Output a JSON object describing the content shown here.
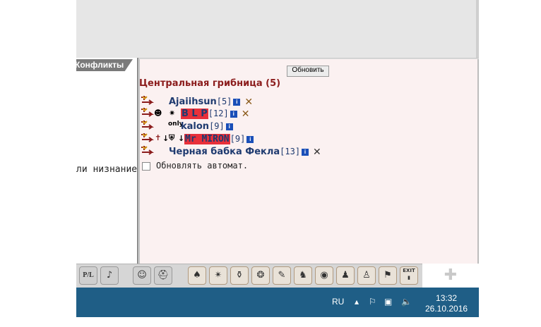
{
  "tabs": {
    "conflicts": "Конфликты"
  },
  "left_panel": {
    "snippet": "ли низнание"
  },
  "chat": {
    "refresh_label": "Обновить",
    "room_title": "Центральная грибница (5)",
    "auto_update_label": "Обновлять автомат.",
    "users": [
      {
        "nick": "Ajaiihsun",
        "level": "[5]",
        "info": "i",
        "x": "✕"
      },
      {
        "nick": "B L P",
        "level": "[12]",
        "info": "i",
        "x": "✕"
      },
      {
        "nick": "kalon",
        "level": "[9]",
        "info": "i",
        "badge": "only"
      },
      {
        "nick": "Mr MIRON",
        "level": "[9]",
        "info": "i"
      },
      {
        "nick": "Черная бабка Фекла",
        "level": "[13]",
        "info": "i",
        "x": "✕"
      }
    ]
  },
  "toolbar": {
    "pl_label": "P/L",
    "icons": [
      "music-icon",
      "smiley-icon",
      "helmet-icon",
      "hood-icon",
      "spark-icon",
      "bag-icon",
      "treasure-icon",
      "scroll-icon",
      "dragon-icon",
      "globe-icon",
      "people-icon",
      "group-icon",
      "flag-icon",
      "exit-icon"
    ],
    "exit_label": "EXIT"
  },
  "taskbar": {
    "lang": "RU",
    "time": "13:32",
    "date": "26.10.2016"
  },
  "colors": {
    "taskbar": "#1f5e86",
    "title": "#8b1c1c",
    "nick": "#1f3b70",
    "highlight": "#e8303a"
  }
}
